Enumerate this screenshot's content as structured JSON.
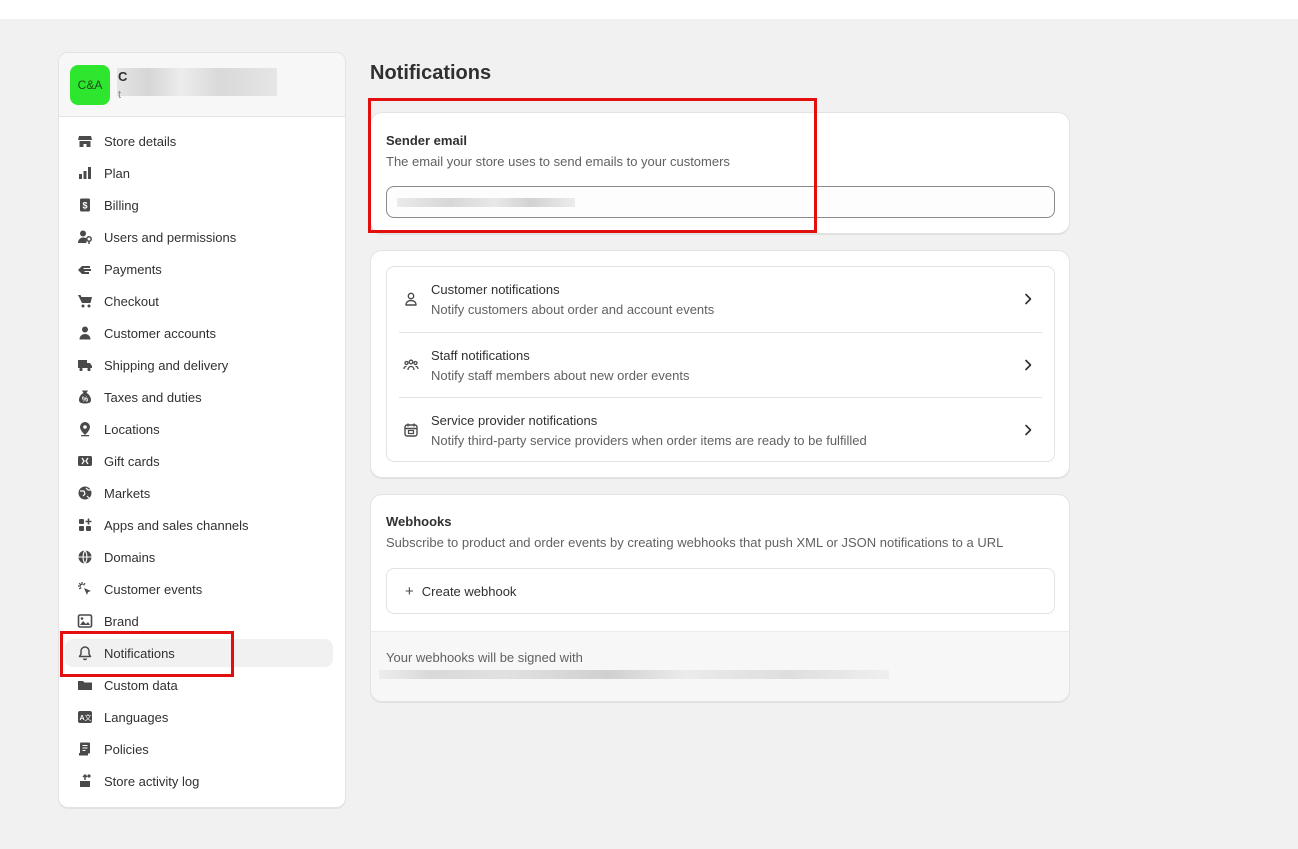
{
  "store": {
    "avatar_text": "C&A",
    "name_initial": "C",
    "sub_initial": "t"
  },
  "sidebar": {
    "items": [
      {
        "label": "Store details",
        "icon": "store-icon"
      },
      {
        "label": "Plan",
        "icon": "plan-icon"
      },
      {
        "label": "Billing",
        "icon": "billing-icon"
      },
      {
        "label": "Users and permissions",
        "icon": "users-icon"
      },
      {
        "label": "Payments",
        "icon": "payments-icon"
      },
      {
        "label": "Checkout",
        "icon": "cart-icon"
      },
      {
        "label": "Customer accounts",
        "icon": "person-icon"
      },
      {
        "label": "Shipping and delivery",
        "icon": "truck-icon"
      },
      {
        "label": "Taxes and duties",
        "icon": "tax-icon"
      },
      {
        "label": "Locations",
        "icon": "location-icon"
      },
      {
        "label": "Gift cards",
        "icon": "gift-card-icon"
      },
      {
        "label": "Markets",
        "icon": "globe-icon"
      },
      {
        "label": "Apps and sales channels",
        "icon": "apps-icon"
      },
      {
        "label": "Domains",
        "icon": "globe-icon"
      },
      {
        "label": "Customer events",
        "icon": "cursor-icon"
      },
      {
        "label": "Brand",
        "icon": "brand-icon"
      },
      {
        "label": "Notifications",
        "icon": "bell-icon",
        "active": true
      },
      {
        "label": "Custom data",
        "icon": "folder-icon"
      },
      {
        "label": "Languages",
        "icon": "language-icon"
      },
      {
        "label": "Policies",
        "icon": "policy-icon"
      },
      {
        "label": "Store activity log",
        "icon": "activity-icon"
      }
    ]
  },
  "main": {
    "title": "Notifications",
    "sender": {
      "title": "Sender email",
      "description": "The email your store uses to send emails to your customers"
    },
    "notifications": [
      {
        "title": "Customer notifications",
        "description": "Notify customers about order and account events",
        "icon": "person-icon"
      },
      {
        "title": "Staff notifications",
        "description": "Notify staff members about new order events",
        "icon": "staff-icon"
      },
      {
        "title": "Service provider notifications",
        "description": "Notify third-party service providers when order items are ready to be fulfilled",
        "icon": "calendar-icon"
      }
    ],
    "webhooks": {
      "title": "Webhooks",
      "description": "Subscribe to product and order events by creating webhooks that push XML or JSON notifications to a URL",
      "create_label": "Create webhook",
      "signed_text": "Your webhooks will be signed with"
    }
  },
  "colors": {
    "highlight": "#e30e0e",
    "avatar": "#2ee62e"
  }
}
